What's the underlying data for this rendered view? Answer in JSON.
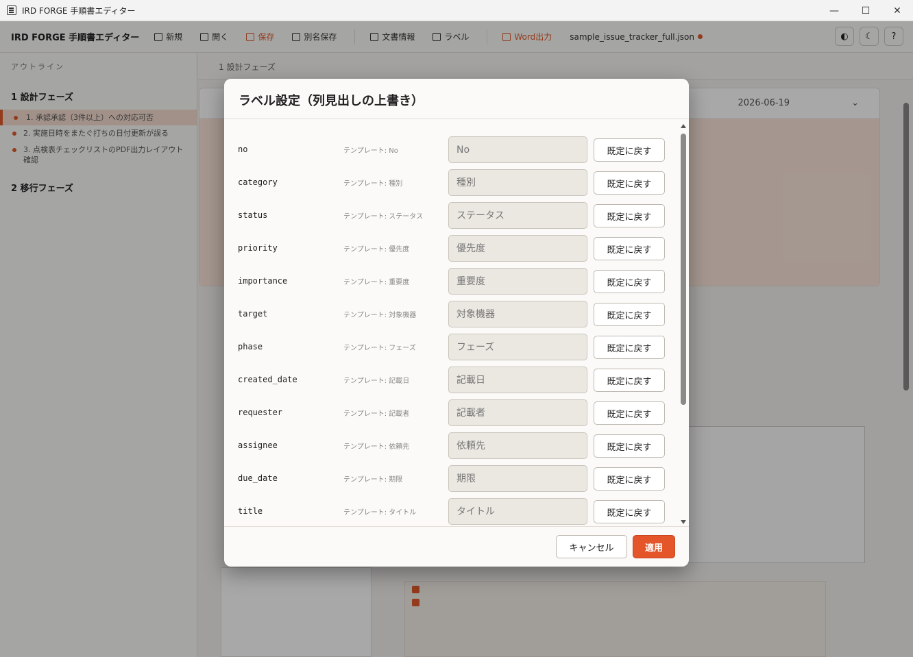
{
  "window": {
    "title": "IRD FORGE 手順書エディター",
    "controls": {
      "minimize": "—",
      "maximize": "☐",
      "close": "✕"
    }
  },
  "toolbar": {
    "brand": "IRD FORGE 手順書エディター",
    "items": [
      "新規",
      "開く",
      "保存",
      "別名保存",
      "文書情報",
      "ラベル",
      "Word出力"
    ],
    "filename": "sample_issue_tracker_full.json",
    "accent_color": "#e05a2b"
  },
  "sidebar": {
    "title": "アウトライン",
    "phases": [
      {
        "label": "1 設計フェーズ",
        "steps": [
          "1. 承認承認（3件以上）への対応可否",
          "2. 実施日時をまたぐ打ちの日付更新が誤る",
          "3. 点検表チェックリストのPDF出力レイアウト確認"
        ]
      },
      {
        "label": "2 移行フェーズ",
        "steps": []
      }
    ]
  },
  "main": {
    "breadcrumb": "1 設計フェーズ",
    "card_date": "2026-06-19"
  },
  "modal": {
    "title": "ラベル設定（列見出しの上書き）",
    "reset_label": "既定に戻す",
    "rows": [
      {
        "key": "no",
        "template": "テンプレート: No",
        "value": "No"
      },
      {
        "key": "category",
        "template": "テンプレート: 種別",
        "value": "種別"
      },
      {
        "key": "status",
        "template": "テンプレート: ステータス",
        "value": "ステータス"
      },
      {
        "key": "priority",
        "template": "テンプレート: 優先度",
        "value": "優先度"
      },
      {
        "key": "importance",
        "template": "テンプレート: 重要度",
        "value": "重要度"
      },
      {
        "key": "target",
        "template": "テンプレート: 対象機器",
        "value": "対象機器"
      },
      {
        "key": "phase",
        "template": "テンプレート: フェーズ",
        "value": "フェーズ"
      },
      {
        "key": "created_date",
        "template": "テンプレート: 記載日",
        "value": "記載日"
      },
      {
        "key": "requester",
        "template": "テンプレート: 記載者",
        "value": "記載者"
      },
      {
        "key": "assignee",
        "template": "テンプレート: 依頼先",
        "value": "依頼先"
      },
      {
        "key": "due_date",
        "template": "テンプレート: 期限",
        "value": "期限"
      },
      {
        "key": "title",
        "template": "テンプレート: タイトル",
        "value": "タイトル"
      }
    ],
    "cancel_label": "キャンセル",
    "apply_label": "適用",
    "apply_color": "#e4552a"
  }
}
